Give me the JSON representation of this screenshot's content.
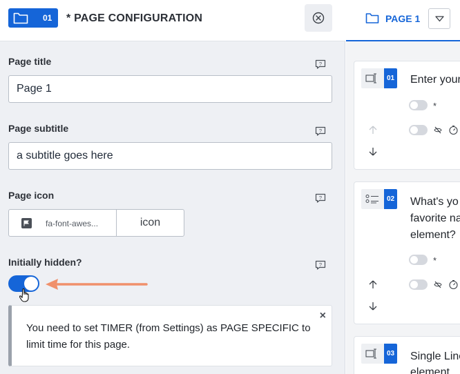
{
  "left_panel": {
    "header": {
      "page_number": "01",
      "title": "* PAGE CONFIGURATION"
    },
    "fields": {
      "page_title": {
        "label": "Page title",
        "value": "Page 1"
      },
      "page_subtitle": {
        "label": "Page subtitle",
        "value": "a subtitle goes here"
      },
      "page_icon": {
        "label": "Page icon",
        "icon_name": "fa-font-awes...",
        "button_label": "icon"
      },
      "initially_hidden": {
        "label": "Initially hidden?",
        "value": true
      }
    },
    "note": {
      "text": "You need to set TIMER (from Settings) as PAGE SPECIFIC to limit time for this page.",
      "close": "×"
    }
  },
  "right_panel": {
    "header": {
      "title": "PAGE 1"
    },
    "questions": [
      {
        "number": "01",
        "text": "Enter your"
      },
      {
        "number": "02",
        "text_lines": [
          "What's yo",
          "favorite na",
          "element?"
        ]
      },
      {
        "number": "03",
        "text_lines": [
          "Single Line",
          "element"
        ]
      }
    ],
    "required_marker": "*"
  },
  "colors": {
    "accent": "#1565d8",
    "annotation_arrow": "#f0906b",
    "panel_bg": "#eef0f4"
  }
}
